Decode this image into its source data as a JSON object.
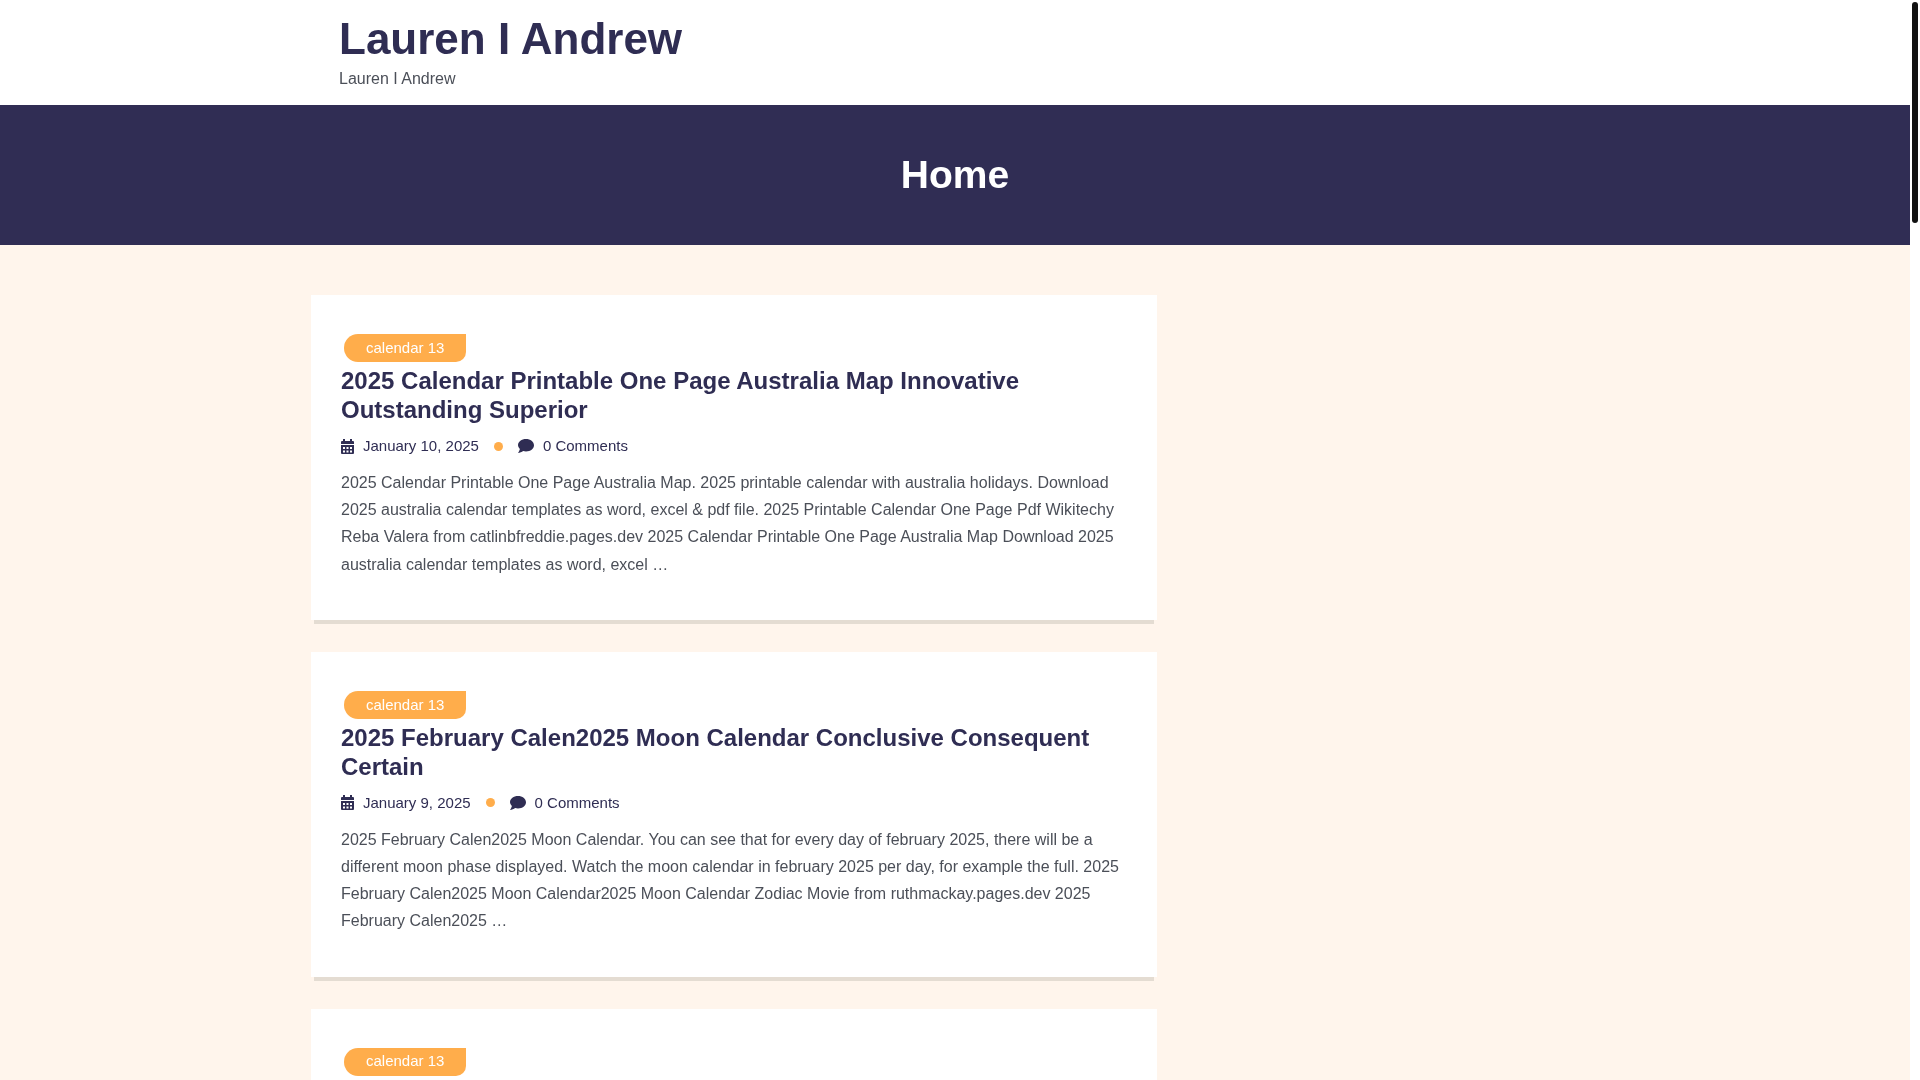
{
  "site": {
    "title": "Lauren I Andrew",
    "tagline": "Lauren I Andrew"
  },
  "banner": {
    "title": "Home"
  },
  "posts": [
    {
      "category": "calendar 13",
      "title": "2025 Calendar Printable One Page Australia Map Innovative Outstanding Superior",
      "date": "January 10, 2025",
      "comments": "0 Comments",
      "excerpt": "2025 Calendar Printable One Page Australia Map. 2025 printable calendar with australia holidays. Download 2025 australia calendar templates as word, excel & pdf file. 2025 Printable Calendar One Page Pdf Wikitechy Reba Valera from catlinbfreddie.pages.dev 2025 Calendar Printable One Page Australia Map Download 2025 australia calendar templates as word, excel …"
    },
    {
      "category": "calendar 13",
      "title": "2025 February Calen2025 Moon Calendar Conclusive Consequent Certain",
      "date": "January 9, 2025",
      "comments": "0 Comments",
      "excerpt": "2025 February Calen2025 Moon Calendar. You can see that for every day of february 2025, there will be a different moon phase displayed. Watch the moon calendar in february 2025 per day, for example the full. 2025 February Calen2025 Moon Calendar2025 Moon Calendar Zodiac Movie from ruthmackay.pages.dev 2025 February Calen2025 …"
    },
    {
      "category": "calendar 13"
    }
  ]
}
